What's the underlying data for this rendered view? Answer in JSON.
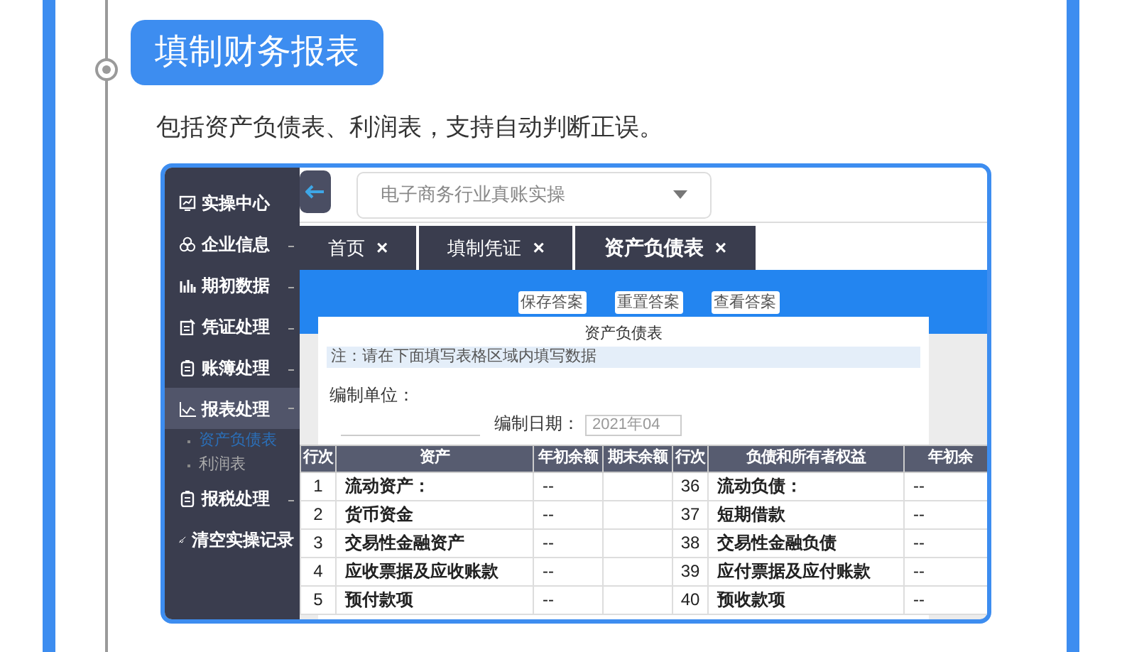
{
  "heading": "填制财务报表",
  "description": "包括资产负债表、利润表，支持自动判断正误。",
  "app": {
    "sidebar": [
      {
        "label": "实操中心",
        "kind": "monitor",
        "expanded": false,
        "has_caret": false
      },
      {
        "label": "企业信息",
        "kind": "circles",
        "expanded": false,
        "has_caret": true
      },
      {
        "label": "期初数据",
        "kind": "bars",
        "expanded": false,
        "has_caret": true
      },
      {
        "label": "凭证处理",
        "kind": "doc",
        "expanded": false,
        "has_caret": true
      },
      {
        "label": "账簿处理",
        "kind": "clipboard",
        "expanded": false,
        "has_caret": true
      },
      {
        "label": "报表处理",
        "kind": "chart",
        "expanded": true,
        "has_caret": true,
        "children": [
          {
            "label": "资产负债表",
            "selected": true
          },
          {
            "label": "利润表",
            "selected": false
          }
        ]
      },
      {
        "label": "报税处理",
        "kind": "clipboard",
        "expanded": false,
        "has_caret": true
      },
      {
        "label": "清空实操记录",
        "kind": "brush",
        "expanded": false,
        "has_caret": false
      }
    ],
    "company_select": {
      "value": "电子商务行业真账实操"
    },
    "tabs": [
      {
        "label": "首页",
        "selected": false,
        "close": "×"
      },
      {
        "label": "填制凭证",
        "selected": false,
        "close": "×"
      },
      {
        "label": "资产负债表",
        "selected": true,
        "close": "×"
      }
    ],
    "buttons": [
      "保存答案",
      "重置答案",
      "查看答案"
    ],
    "form": {
      "title": "资产负债表",
      "note": "注：请在下面填写表格区域内填写数据",
      "unit_label": "编制单位：",
      "date_label": "编制日期：",
      "date_value": "2021年04",
      "columns": [
        "行次",
        "资产",
        "年初余额",
        "期末余额",
        "行次",
        "负债和所有者权益",
        "年初余"
      ],
      "rows": [
        [
          "1",
          "流动资产：",
          "--",
          "",
          "36",
          "流动负债：",
          "--"
        ],
        [
          "2",
          "货币资金",
          "--",
          "",
          "37",
          "短期借款",
          "--"
        ],
        [
          "3",
          "交易性金融资产",
          "--",
          "",
          "38",
          "交易性金融负债",
          "--"
        ],
        [
          "4",
          "应收票据及应收账款",
          "--",
          "",
          "39",
          "应付票据及应付账款",
          "--"
        ],
        [
          "5",
          "预付款项",
          "--",
          "",
          "40",
          "预收款项",
          "--"
        ]
      ]
    }
  }
}
